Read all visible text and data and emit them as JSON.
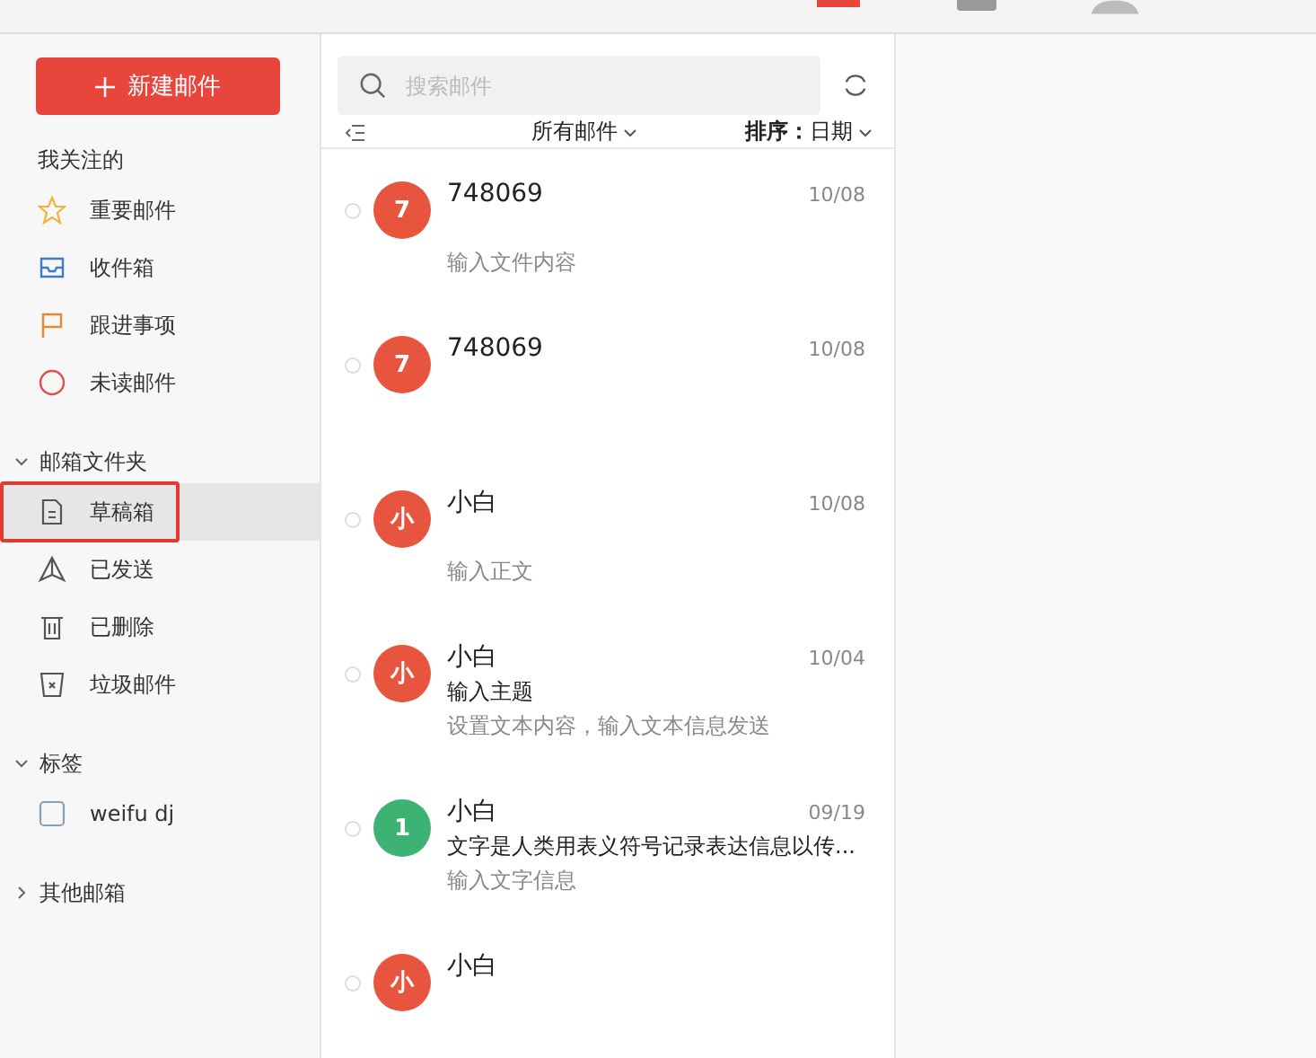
{
  "compose_button": "新建邮件",
  "sidebar": [
    {
      "title": "我关注的",
      "items": [
        {
          "label": "重要邮件",
          "selected": false
        },
        {
          "label": "收件箱",
          "selected": false
        },
        {
          "label": "跟进事项",
          "selected": false
        },
        {
          "label": "未读邮件",
          "selected": false
        }
      ]
    },
    {
      "title": "邮箱文件夹",
      "expanded": true,
      "items": [
        {
          "label": "草稿箱",
          "selected": true
        },
        {
          "label": "已发送",
          "selected": false
        },
        {
          "label": "已删除",
          "selected": false
        },
        {
          "label": "垃圾邮件",
          "selected": false
        }
      ]
    },
    {
      "title": "标签",
      "expanded": true,
      "items": [
        {
          "label": "weifu dj",
          "selected": false
        }
      ]
    },
    {
      "title": "其他邮箱",
      "expanded": false
    }
  ],
  "search": {
    "placeholder": "搜索邮件"
  },
  "filter": "所有邮件",
  "sort_label": "排序：",
  "sort_value": "日期",
  "mails": [
    {
      "avatar": "7",
      "color": "#e8553f",
      "sender": "748069",
      "date": "10/08",
      "preview": "输入文件内容"
    },
    {
      "avatar": "7",
      "color": "#e8553f",
      "sender": "748069",
      "date": "10/08"
    },
    {
      "avatar": "小",
      "color": "#e8553f",
      "sender": "小白",
      "date": "10/08",
      "preview": "输入正文"
    },
    {
      "avatar": "小",
      "color": "#e8553f",
      "sender": "小白",
      "date": "10/04",
      "subject": "输入主题",
      "preview": "设置文本内容，输入文本信息发送"
    },
    {
      "avatar": "1",
      "color": "#3db373",
      "sender": "小白",
      "date": "09/19",
      "subject": "文字是人类用表义符号记录表达信息以传...",
      "preview": "输入文字信息"
    },
    {
      "avatar": "小",
      "color": "#e8553f",
      "sender": "小白"
    }
  ]
}
